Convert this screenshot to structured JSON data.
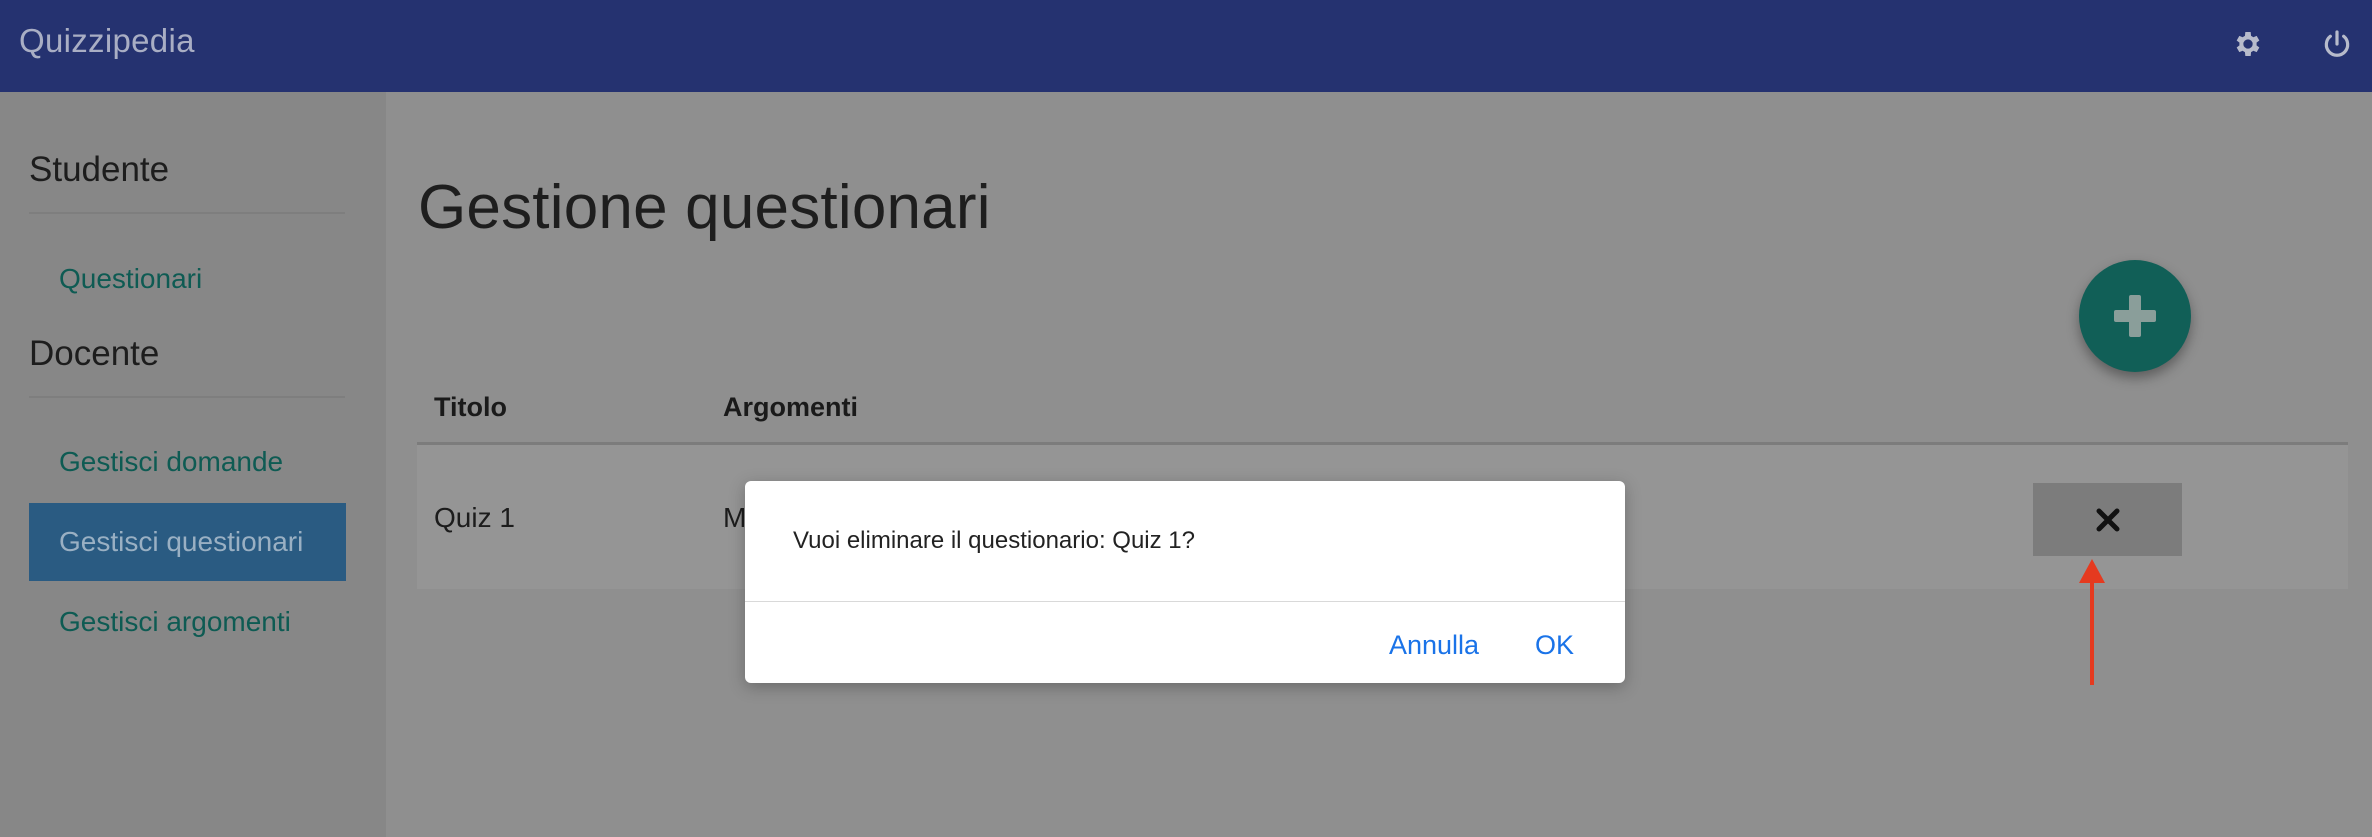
{
  "header": {
    "brand": "Quizzipedia",
    "settings_icon": "gear-icon",
    "logout_icon": "power-icon"
  },
  "sidebar": {
    "sections": [
      {
        "title": "Studente",
        "items": [
          {
            "label": "Questionari"
          }
        ]
      },
      {
        "title": "Docente",
        "items": [
          {
            "label": "Gestisci domande"
          },
          {
            "label": "Gestisci questionari",
            "active": true
          },
          {
            "label": "Gestisci argomenti"
          }
        ]
      }
    ]
  },
  "main": {
    "title": "Gestione questionari",
    "add_icon": "plus-icon",
    "table": {
      "columns": [
        "Titolo",
        "Argomenti"
      ],
      "rows": [
        {
          "titolo": "Quiz 1",
          "argomenti": "M"
        }
      ],
      "delete_icon": "x-icon"
    }
  },
  "dialog": {
    "message": "Vuoi eliminare il questionario: Quiz 1?",
    "cancel_label": "Annulla",
    "ok_label": "OK"
  },
  "colors": {
    "navbar": "#253270",
    "accent": "#115f57",
    "active_item": "#2a5b82",
    "link_button": "#1a73e8",
    "annotation_arrow": "#e53a1f"
  }
}
